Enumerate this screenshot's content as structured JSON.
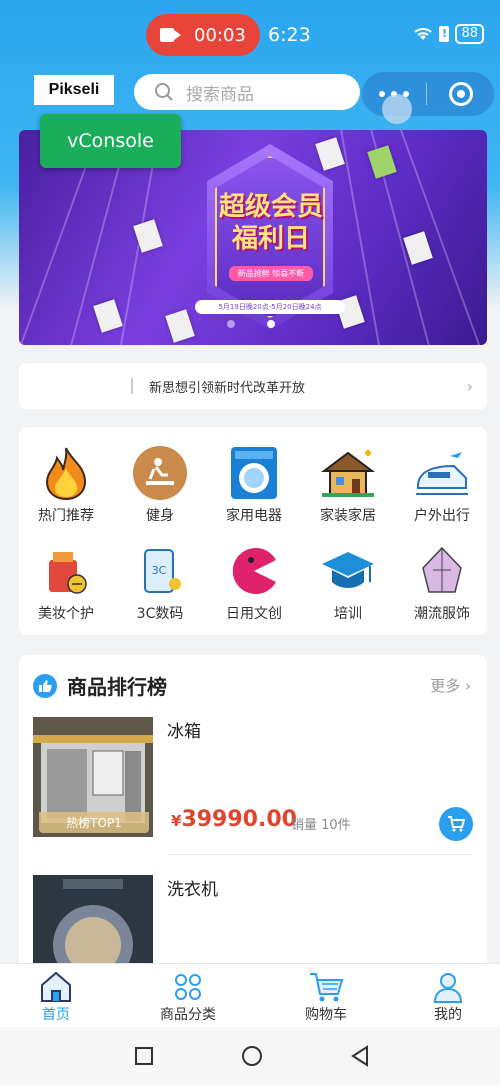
{
  "status": {
    "record_time": "00:03",
    "clock": "6:23",
    "battery": "88"
  },
  "header": {
    "logo": "Pikseli",
    "search_placeholder": "搜索商品"
  },
  "vconsole": {
    "label": "vConsole"
  },
  "banner": {
    "line1": "超级会员",
    "line2": "福利日",
    "tagline": "新品抢鲜 惊喜不断",
    "date": "5月19日晚20点-5月20日晚24点"
  },
  "notice": {
    "text": "新思想引领新时代改革开放"
  },
  "categories": [
    {
      "label": "热门推荐",
      "icon": "fire-icon"
    },
    {
      "label": "健身",
      "icon": "fitness-icon"
    },
    {
      "label": "家用电器",
      "icon": "washing-machine-icon"
    },
    {
      "label": "家装家居",
      "icon": "house-icon"
    },
    {
      "label": "户外出行",
      "icon": "train-icon"
    },
    {
      "label": "美妆个护",
      "icon": "cosmetics-icon"
    },
    {
      "label": "3C数码",
      "icon": "phone-icon"
    },
    {
      "label": "日用文创",
      "icon": "pacman-icon"
    },
    {
      "label": "培训",
      "icon": "graduation-cap-icon"
    },
    {
      "label": "潮流服饰",
      "icon": "clothes-icon"
    }
  ],
  "ranking": {
    "title": "商品排行榜",
    "more": "更多",
    "products": [
      {
        "name": "冰箱",
        "price": "39990.00",
        "currency": "¥",
        "sales": "销量 10件",
        "badge": "热榜TOP1"
      },
      {
        "name": "洗衣机"
      }
    ]
  },
  "tabbar": {
    "items": [
      {
        "label": "首页",
        "icon": "home-icon",
        "active": true
      },
      {
        "label": "商品分类",
        "icon": "category-icon"
      },
      {
        "label": "购物车",
        "icon": "cart-icon"
      },
      {
        "label": "我的",
        "icon": "user-icon"
      }
    ]
  },
  "colors": {
    "brand_blue": "#2a9ff0",
    "price_red": "#e0452e",
    "record_red": "#e8443a",
    "vconsole_green": "#1aad5a"
  }
}
